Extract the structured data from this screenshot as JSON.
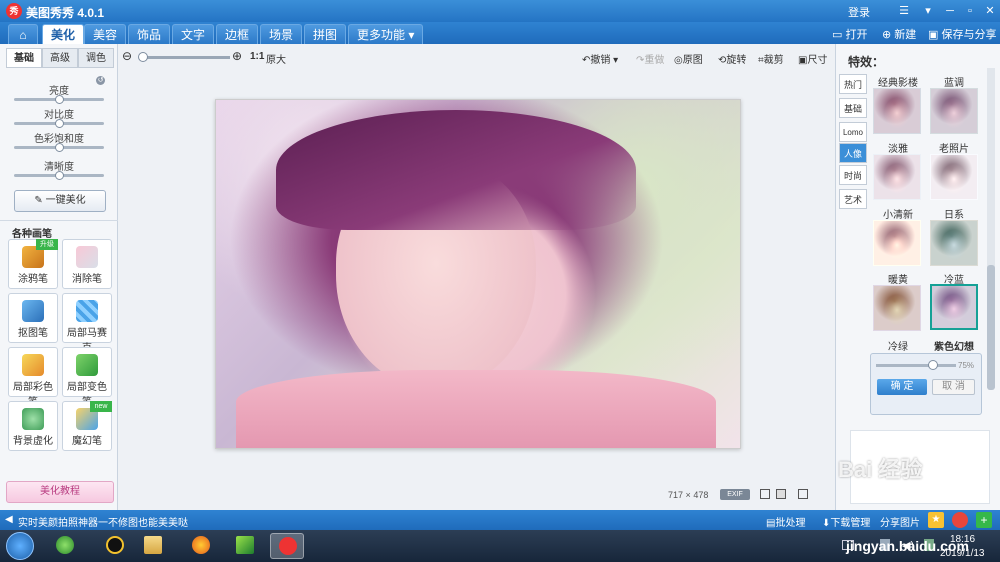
{
  "window": {
    "title": "美图秀秀 4.0.1",
    "logo": "秀",
    "login": "登录"
  },
  "nav": {
    "home_icon": "home-icon",
    "tabs": [
      "美化",
      "美容",
      "饰品",
      "文字",
      "边框",
      "场景",
      "拼图",
      "更多功能 ▾"
    ],
    "active": "美化"
  },
  "top_actions": {
    "open": "打开",
    "new": "新建",
    "save_share": "保存与分享"
  },
  "left": {
    "subtabs": [
      "基础",
      "高级",
      "调色"
    ],
    "sliders": [
      {
        "label": "亮度",
        "level": 0.5
      },
      {
        "label": "对比度",
        "level": 0.5
      },
      {
        "label": "色彩饱和度",
        "level": 0.5
      },
      {
        "label": "清晰度",
        "level": 0.5
      }
    ],
    "one_key": "一键美化",
    "brush_title": "各种画笔",
    "brushes": [
      {
        "label": "涂鸦笔",
        "badge": "升级"
      },
      {
        "label": "消除笔"
      },
      {
        "label": "抠图笔"
      },
      {
        "label": "局部马赛克"
      },
      {
        "label": "局部彩色笔"
      },
      {
        "label": "局部变色笔"
      },
      {
        "label": "背景虚化"
      },
      {
        "label": "魔幻笔",
        "badge": "new"
      }
    ],
    "tutorial": "美化教程"
  },
  "toolbar": {
    "zoom_ratio": "1:1",
    "zoom_original": "原大",
    "undo": "撤销",
    "redo": "重做",
    "original": "原图",
    "rotate": "旋转",
    "crop": "裁剪",
    "size": "尺寸"
  },
  "photo": {
    "width": "717",
    "x": "×",
    "height": "478",
    "exif": "EXIF"
  },
  "right": {
    "title": "特效：",
    "categories": [
      "热门",
      "基础",
      "Lomo",
      "人像",
      "时尚",
      "艺术"
    ],
    "active_category": "人像",
    "effects": [
      "经典影楼",
      "蓝调",
      "淡雅",
      "老照片",
      "小清新",
      "日系",
      "暖黄",
      "冷蓝",
      "冷绿",
      "紫色幻想"
    ],
    "selected": "紫色幻想",
    "intensity": "75%",
    "ok": "确 定",
    "cancel": "取 消"
  },
  "status": {
    "tip": "实时美颜拍照神器一不修图也能美美哒",
    "batch": "批处理",
    "download": "下载管理",
    "share": "分享图片"
  },
  "taskbar": {
    "time": "18:16",
    "date": "2019/1/13"
  },
  "watermark": {
    "text": "Bai 经验",
    "url": "jingyan.baidu.com"
  }
}
